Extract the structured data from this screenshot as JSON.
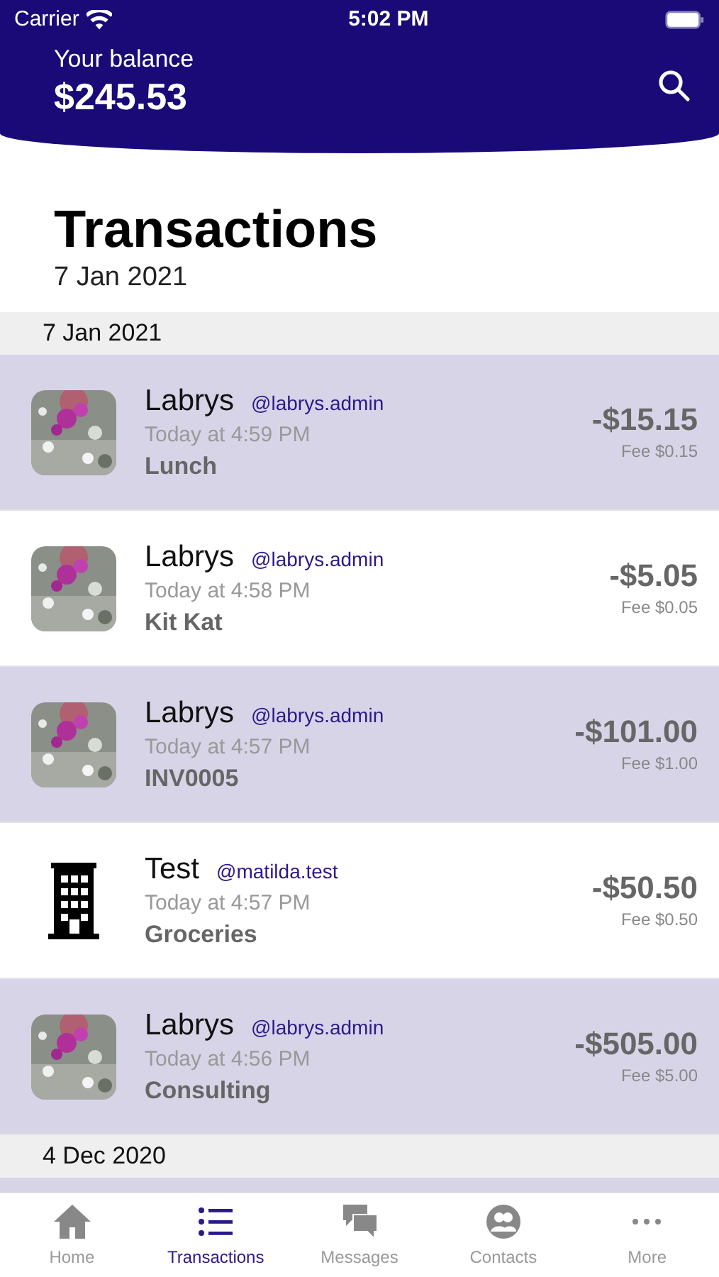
{
  "status_bar": {
    "carrier": "Carrier",
    "time": "5:02 PM"
  },
  "header": {
    "label": "Your balance",
    "balance": "$245.53"
  },
  "title": "Transactions",
  "subtitle": "7 Jan 2021",
  "sections": [
    {
      "date": "7 Jan 2021",
      "rows": [
        {
          "kind": "picture",
          "highlighted": true,
          "name": "Labrys",
          "handle": "@labrys.admin",
          "time": "Today at 4:59 PM",
          "memo": "Lunch",
          "amount": "-$15.15",
          "fee": "Fee $0.15"
        },
        {
          "kind": "picture",
          "highlighted": false,
          "name": "Labrys",
          "handle": "@labrys.admin",
          "time": "Today at 4:58 PM",
          "memo": "Kit Kat",
          "amount": "-$5.05",
          "fee": "Fee $0.05"
        },
        {
          "kind": "picture",
          "highlighted": true,
          "name": "Labrys",
          "handle": "@labrys.admin",
          "time": "Today at 4:57 PM",
          "memo": "INV0005",
          "amount": "-$101.00",
          "fee": "Fee $1.00"
        },
        {
          "kind": "building",
          "highlighted": false,
          "name": "Test",
          "handle": "@matilda.test",
          "time": "Today at 4:57 PM",
          "memo": "Groceries",
          "amount": "-$50.50",
          "fee": "Fee $0.50"
        },
        {
          "kind": "picture",
          "highlighted": true,
          "name": "Labrys",
          "handle": "@labrys.admin",
          "time": "Today at 4:56 PM",
          "memo": "Consulting",
          "amount": "-$505.00",
          "fee": "Fee $5.00"
        }
      ]
    },
    {
      "date": "4 Dec 2020"
    }
  ],
  "tabs": [
    {
      "kind": "home",
      "label": "Home",
      "selected": false
    },
    {
      "kind": "list",
      "label": "Transactions",
      "selected": true
    },
    {
      "kind": "messages",
      "label": "Messages",
      "selected": false
    },
    {
      "kind": "contacts",
      "label": "Contacts",
      "selected": false
    },
    {
      "kind": "more",
      "label": "More",
      "selected": false
    }
  ]
}
